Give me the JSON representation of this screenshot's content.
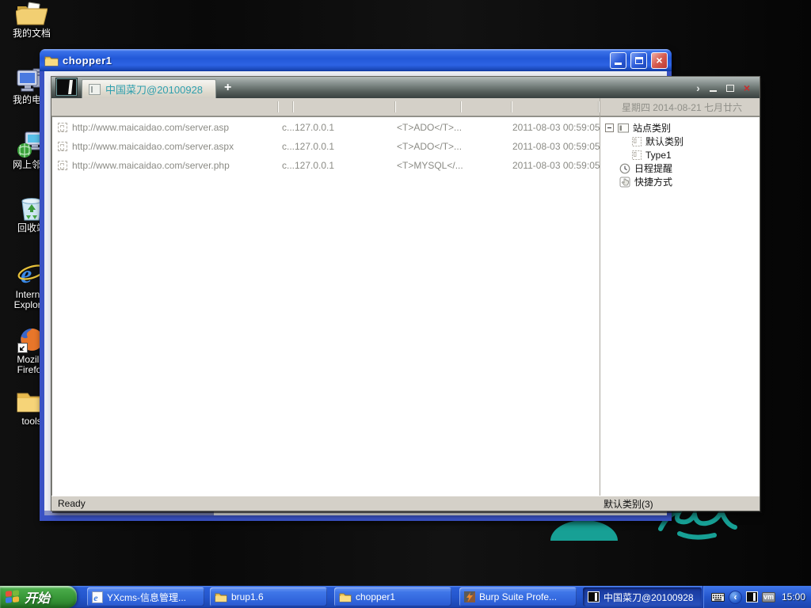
{
  "colors": {
    "taskbar_blue": "#2456cc",
    "title_bar_blue": "#2258d8",
    "start_green": "#379637",
    "tab_text_teal": "#2f9fae",
    "wallpaper_teal": "#17a095",
    "close_red": "#c92c2c",
    "window_chrome_gray": "#d4d0c8"
  },
  "desktop": {
    "icons": [
      {
        "label": "我的文档"
      },
      {
        "label": "我的电脑"
      },
      {
        "label": "网上邻居"
      },
      {
        "label": "回收站"
      },
      {
        "label": "Internet Explorer"
      },
      {
        "label": "Mozilla Firefox"
      },
      {
        "label": "tools"
      }
    ]
  },
  "explorer_window": {
    "title": "chopper1"
  },
  "chopper_window": {
    "tab_title": "中国菜刀@20100928",
    "new_tab": "+",
    "chevron": "›",
    "close_glyph": "×",
    "date_text": "星期四 2014-08-21 七月廿六",
    "list": {
      "rows": [
        {
          "url": "http://www.maicaidao.com/server.asp",
          "col2": "c...",
          "ip": "127.0.0.1",
          "config": "<T>ADO</T>...",
          "time": "2011-08-03 00:59:05"
        },
        {
          "url": "http://www.maicaidao.com/server.aspx",
          "col2": "c...",
          "ip": "127.0.0.1",
          "config": "<T>ADO</T>...",
          "time": "2011-08-03 00:59:05"
        },
        {
          "url": "http://www.maicaidao.com/server.php",
          "col2": "c...",
          "ip": "127.0.0.1",
          "config": "<T>MYSQL</...",
          "time": "2011-08-03 00:59:05"
        }
      ]
    },
    "tree": {
      "items": [
        {
          "label": "站点类别"
        },
        {
          "label": "默认类别"
        },
        {
          "label": "Type1"
        },
        {
          "label": "日程提醒"
        },
        {
          "label": "快捷方式"
        }
      ]
    },
    "status_left": "Ready",
    "status_right": "默认类别(3)"
  },
  "taskbar": {
    "start_label": "开始",
    "tasks": [
      {
        "label": "YXcms-信息管理..."
      },
      {
        "label": "brup1.6"
      },
      {
        "label": "chopper1"
      },
      {
        "label": "Burp Suite Profe..."
      },
      {
        "label": "中国菜刀@20100928"
      }
    ],
    "tray": {
      "lang_glyph": "‹",
      "vm_label": "vm",
      "clock": "15:00"
    }
  }
}
